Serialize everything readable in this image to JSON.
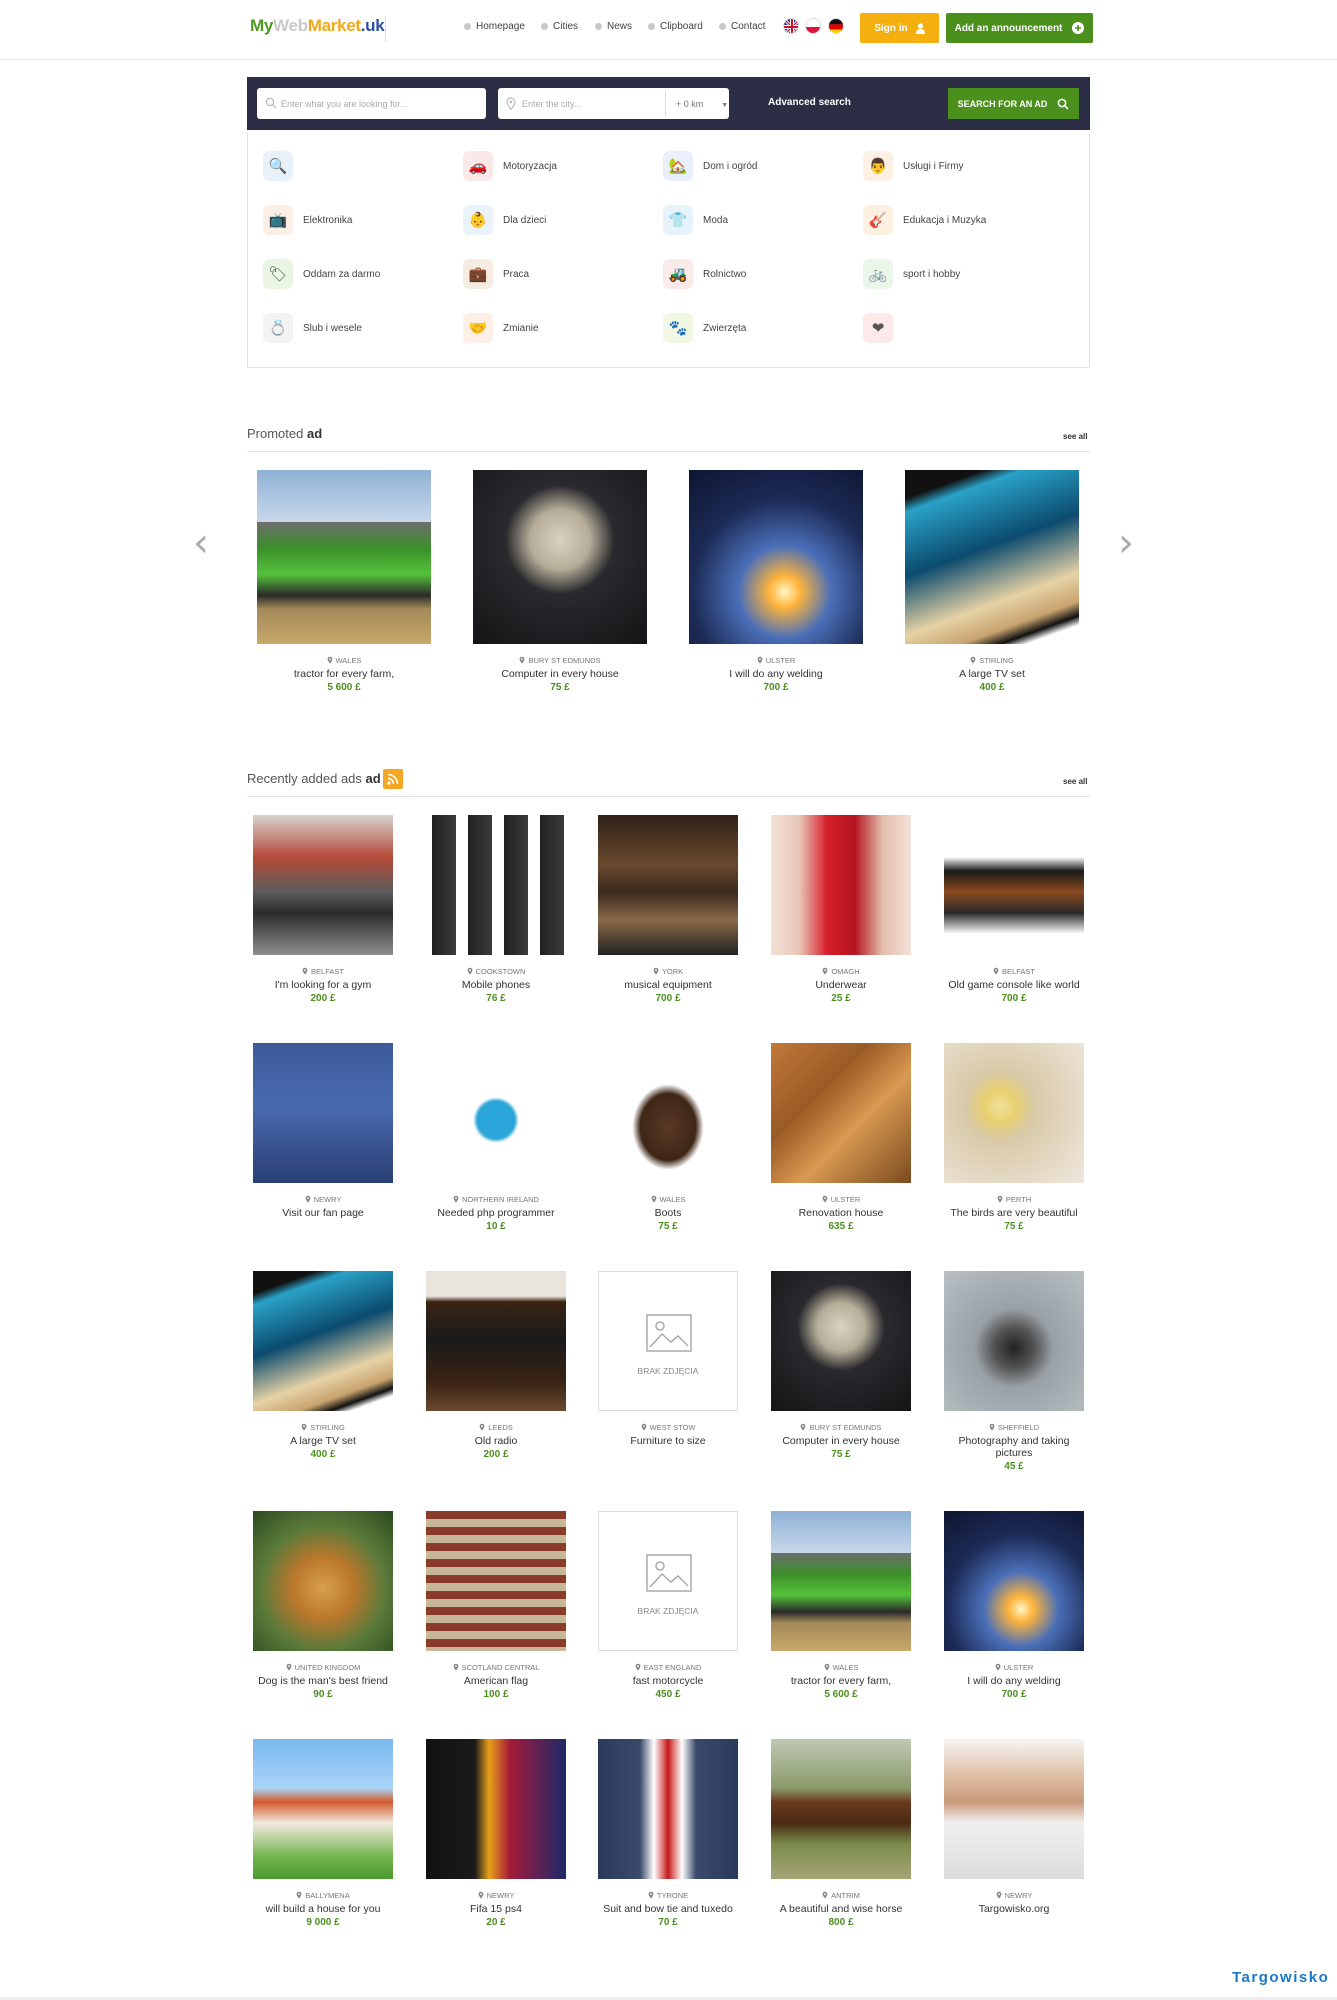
{
  "header": {
    "logo": {
      "part1": "My",
      "part2": "Web",
      "part3": "Market",
      "part4": ".uk"
    },
    "nav": [
      "Homepage",
      "Cities",
      "News",
      "Clipboard",
      "Contact"
    ],
    "flags": [
      "uk-flag",
      "pl-flag",
      "de-flag"
    ],
    "sign_in": "Sign in",
    "add_announcement": "Add an announcement"
  },
  "search": {
    "query_placeholder": "Enter what you are looking for...",
    "city_placeholder": "Enter the city...",
    "radius": "+ 0 km",
    "advanced": "Advanced search",
    "button": "SEARCH FOR AN AD"
  },
  "categories": [
    {
      "label": "",
      "icon": "search-icon"
    },
    {
      "label": "Motoryzacja",
      "icon": "car-icon"
    },
    {
      "label": "Dom i ogród",
      "icon": "house-garden-icon"
    },
    {
      "label": "Usługi i Firmy",
      "icon": "businessman-icon"
    },
    {
      "label": "Elektronika",
      "icon": "tv-icon"
    },
    {
      "label": "Dla dzieci",
      "icon": "baby-icon"
    },
    {
      "label": "Moda",
      "icon": "shirt-icon"
    },
    {
      "label": "Edukacja i Muzyka",
      "icon": "guitar-icon"
    },
    {
      "label": "Oddam za darmo",
      "icon": "free-tag-icon"
    },
    {
      "label": "Praca",
      "icon": "briefcase-icon"
    },
    {
      "label": "Rolnictwo",
      "icon": "tractor-icon"
    },
    {
      "label": "sport i hobby",
      "icon": "bicycle-icon"
    },
    {
      "label": "Slub i wesele",
      "icon": "wedding-icon"
    },
    {
      "label": "Zmianie",
      "icon": "handshake-icon"
    },
    {
      "label": "Zwierzęta",
      "icon": "animals-icon"
    },
    {
      "label": "",
      "icon": "heart-pulse-icon"
    }
  ],
  "promoted": {
    "title_plain": "Promoted",
    "title_bold": "ad",
    "see_all": "see all",
    "items": [
      {
        "loc": "WALES",
        "title": "tractor for every farm,",
        "price": "5 600 £",
        "img": "tractor"
      },
      {
        "loc": "BURY ST EDMUNDS",
        "title": "Computer in every house",
        "price": "75 £",
        "img": "computer"
      },
      {
        "loc": "ULSTER",
        "title": "I will do any welding",
        "price": "700 £",
        "img": "welding"
      },
      {
        "loc": "STIRLING",
        "title": "A large TV set",
        "price": "400 £",
        "img": "tv"
      }
    ]
  },
  "recent": {
    "title_plain": "Recently added ads",
    "title_bold": "ad",
    "see_all": "see all",
    "no_photo": "BRAK ZDJĘCIA",
    "items": [
      {
        "loc": "BELFAST",
        "title": "I'm looking for a gym",
        "price": "200 £",
        "img": "gym"
      },
      {
        "loc": "COOKSTOWN",
        "title": "Mobile phones",
        "price": "76 £",
        "img": "phones"
      },
      {
        "loc": "YORK",
        "title": "musical equipment",
        "price": "700 £",
        "img": "music"
      },
      {
        "loc": "OMAGH",
        "title": "Underwear",
        "price": "25 £",
        "img": "underwear"
      },
      {
        "loc": "BELFAST",
        "title": "Old game console like world",
        "price": "700 £",
        "img": "console"
      },
      {
        "loc": "NEWRY",
        "title": "Visit our fan page",
        "price": "",
        "img": "fanpage"
      },
      {
        "loc": "NORTHERN IRELAND",
        "title": "Needed php programmer",
        "price": "10 £",
        "img": "cms"
      },
      {
        "loc": "WALES",
        "title": "Boots",
        "price": "75 £",
        "img": "boots"
      },
      {
        "loc": "ULSTER",
        "title": "Renovation house",
        "price": "635 £",
        "img": "tools"
      },
      {
        "loc": "PERTH",
        "title": "The birds are very beautiful",
        "price": "75 £",
        "img": "bird"
      },
      {
        "loc": "STIRLING",
        "title": "A large TV set",
        "price": "400 £",
        "img": "tv"
      },
      {
        "loc": "LEEDS",
        "title": "Old radio",
        "price": "200 £",
        "img": "radio"
      },
      {
        "loc": "WEST STOW",
        "title": "Furniture to size",
        "price": "",
        "img": "none"
      },
      {
        "loc": "BURY ST EDMUNDS",
        "title": "Computer in every house",
        "price": "75 £",
        "img": "computer"
      },
      {
        "loc": "SHEFFIELD",
        "title": "Photography and taking pictures",
        "price": "45 £",
        "img": "camera"
      },
      {
        "loc": "UNITED KINGDOM",
        "title": "Dog is the man's best friend",
        "price": "90 £",
        "img": "dog"
      },
      {
        "loc": "SCOTLAND CENTRAL",
        "title": "American flag",
        "price": "100 £",
        "img": "flag"
      },
      {
        "loc": "EAST ENGLAND",
        "title": "fast motorcycle",
        "price": "450 £",
        "img": "none"
      },
      {
        "loc": "WALES",
        "title": "tractor for every farm,",
        "price": "5 600 £",
        "img": "tractor"
      },
      {
        "loc": "ULSTER",
        "title": "I will do any welding",
        "price": "700 £",
        "img": "welding"
      },
      {
        "loc": "BALLYMENA",
        "title": "will build a house for you",
        "price": "9 000 £",
        "img": "house"
      },
      {
        "loc": "NEWRY",
        "title": "Fifa 15 ps4",
        "price": "20 £",
        "img": "fifa"
      },
      {
        "loc": "TYRONE",
        "title": "Suit and bow tie and tuxedo",
        "price": "70 £",
        "img": "suit"
      },
      {
        "loc": "ANTRIM",
        "title": "A beautiful and wise horse",
        "price": "800 £",
        "img": "horse"
      },
      {
        "loc": "NEWRY",
        "title": "Targowisko.org",
        "price": "",
        "img": "handshake"
      }
    ]
  },
  "watermark": "Targowisko",
  "colors": {
    "green": "#4b8f1d",
    "orange": "#f5b00f",
    "dark": "#2b2e44",
    "link_blue": "#1a78c8"
  }
}
